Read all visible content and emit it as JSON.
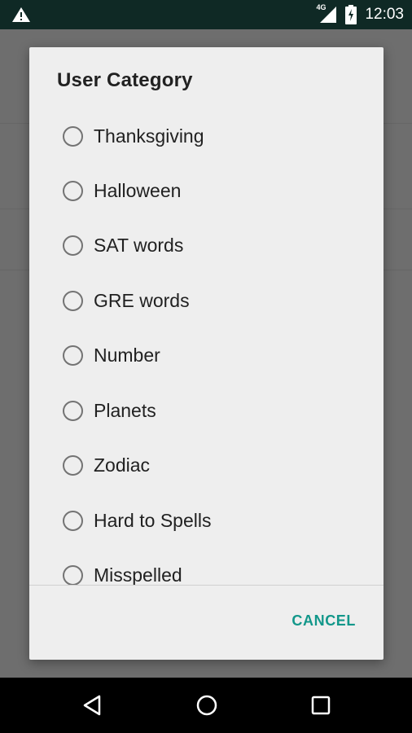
{
  "status_bar": {
    "network": "4G",
    "time": "12:03",
    "icons": [
      "warning-icon",
      "signal-icon",
      "battery-icon"
    ]
  },
  "dialog": {
    "title": "User Category",
    "options": [
      "Thanksgiving",
      "Halloween",
      "SAT words",
      "GRE words",
      "Number",
      "Planets",
      "Zodiac",
      "Hard to Spells",
      "Misspelled"
    ],
    "cancel_label": "CANCEL"
  },
  "nav_bar": {
    "icons": [
      "back-icon",
      "home-icon",
      "recents-icon"
    ]
  },
  "colors": {
    "accent": "#12978a",
    "status_bar": "#0f2925",
    "scrim": "#6e6e6e",
    "dialog_bg": "#eeeeee"
  }
}
